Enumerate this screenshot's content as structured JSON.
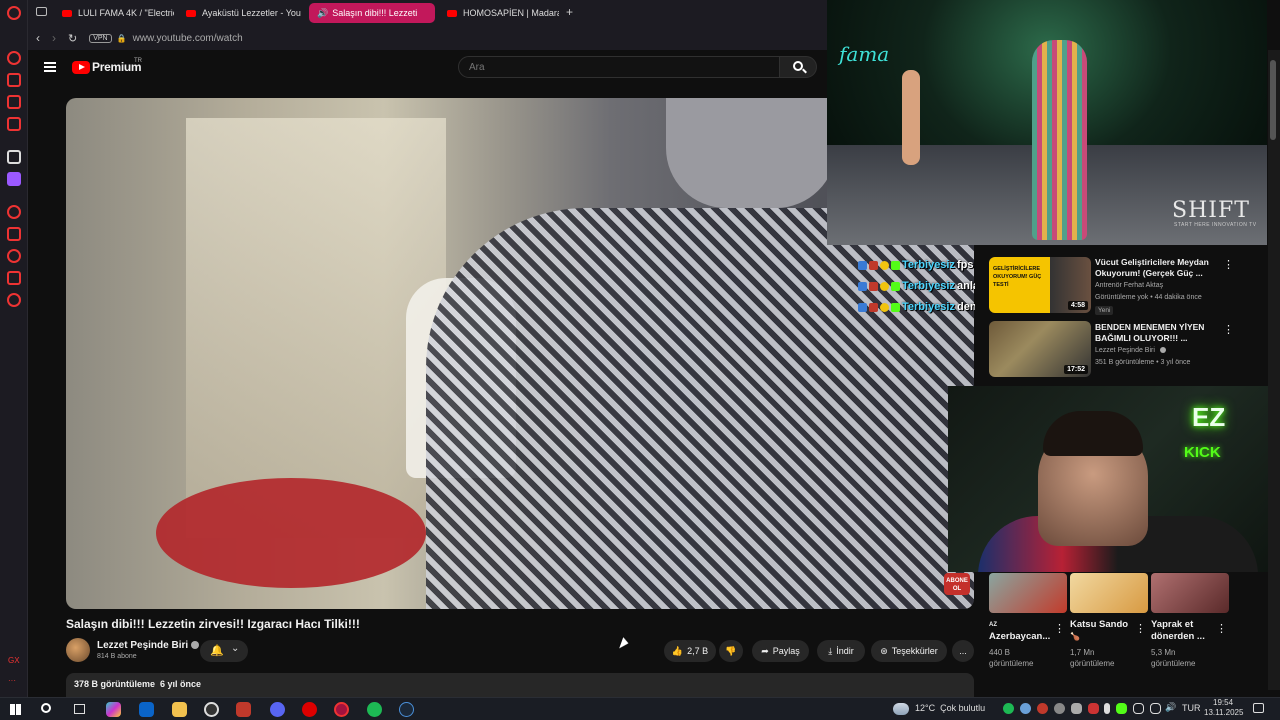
{
  "browser": {
    "tabs": [
      {
        "label": "LULI FAMA 4K / \"Electric",
        "active": false
      },
      {
        "label": "Ayaküstü Lezzetler - You",
        "active": false
      },
      {
        "label": "Salaşın dibi!!! Lezzeti",
        "active": true
      },
      {
        "label": "HOMOSAPİEN | Madara C",
        "active": false
      }
    ],
    "new_tab_label": "+",
    "vpn_label": "VPN",
    "url": "www.youtube.com/watch"
  },
  "youtube": {
    "logo_label": "Premium",
    "logo_suffix": "TR",
    "search_placeholder": "Ara"
  },
  "video": {
    "title": "Salaşın dibi!!! Lezzetin zirvesi!! Izgaracı Hacı Tilki!!!",
    "channel_name": "Lezzet Peşinde Biri",
    "channel_subs": "814 B abone",
    "likes": "2,7 B",
    "share_label": "Paylaş",
    "download_label": "İndir",
    "thanks_label": "Teşekkürler",
    "more_label": "...",
    "description_meta": "378 B görüntüleme  6 yıl önce",
    "subscribe_overlay": "ABONE OL"
  },
  "runway_overlay": {
    "logo_text": "fama",
    "brand": "SHIFT",
    "brand_sub": "START HERE INNOVATION TV"
  },
  "chat": [
    {
      "user": "Terbiyesiz",
      "message": "fps arttırma"
    },
    {
      "user": "Terbiyesiz",
      "message": "anlatıor"
    },
    {
      "user": "Terbiyesiz",
      "message": "deneyek"
    }
  ],
  "recommendations": [
    {
      "title": "Vücut Geliştiricilere Meydan Okuyorum! (Gerçek Güç ...",
      "channel": "Antrenör Ferhat Aktaş",
      "meta": "Görüntüleme yok • 44 dakika önce",
      "badge": "Yeni",
      "duration": "4:58",
      "thumb_text": "GELİŞTİRİCİLERE OKUYORUM! GÜÇ TESTİ"
    },
    {
      "title": "BENDEN MENEMEN YİYEN BAĞIMLI OLUYOR!!! ...",
      "channel": "Lezzet Peşinde Biri",
      "meta": "351 B görüntüleme • 3 yıl önce",
      "duration": "17:52"
    }
  ],
  "streamer_cam": {
    "neon_top": "EZ",
    "neon_bottom": "KICK"
  },
  "shorts": [
    {
      "title_line1": "AZ",
      "title_line2": "Azerbaycan...",
      "views_line1": "440 B",
      "views_line2": "görüntüleme"
    },
    {
      "title_line1": "Katsu Sando",
      "title_line2": "🍗",
      "views_line1": "1,7 Mn",
      "views_line2": "görüntüleme"
    },
    {
      "title_line1": "Yaprak et",
      "title_line2": "dönerden ...",
      "views_line1": "5,3 Mn",
      "views_line2": "görüntüleme"
    }
  ],
  "taskbar": {
    "weather": "12°C  Çok bulutlu",
    "language": "TUR",
    "time": "19:54",
    "date": "13.11.2025"
  },
  "sidebar": {
    "bottom_label": "GX"
  },
  "colors": {
    "accent_youtube": "#ff0000",
    "active_tab": "#c2185b",
    "kick_green": "#53fc18",
    "opera_red": "#e33333"
  }
}
